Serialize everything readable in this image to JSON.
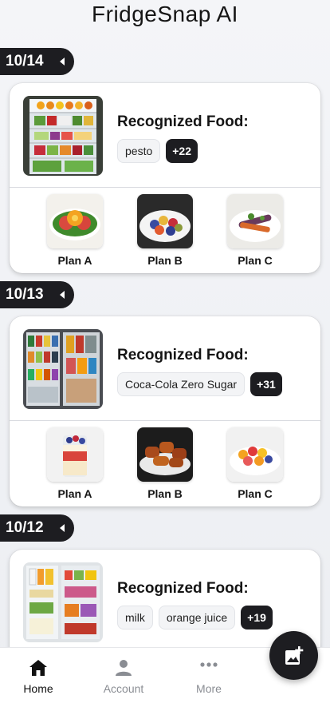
{
  "app": {
    "title": "FridgeSnap AI"
  },
  "labels": {
    "recognized": "Recognized Food:"
  },
  "entries": [
    {
      "date": "10/14",
      "foods": [
        "pesto"
      ],
      "more": "+22",
      "plans": [
        "Plan A",
        "Plan B",
        "Plan C"
      ]
    },
    {
      "date": "10/13",
      "foods": [
        "Coca-Cola Zero Sugar"
      ],
      "more": "+31",
      "plans": [
        "Plan A",
        "Plan B",
        "Plan C"
      ]
    },
    {
      "date": "10/12",
      "foods": [
        "milk",
        "orange juice"
      ],
      "more": "+19"
    }
  ],
  "tabbar": {
    "home": "Home",
    "account": "Account",
    "more": "More"
  },
  "colors": {
    "dark": "#1d1d21",
    "active_tab": "#111111",
    "inactive_tab": "#8a8d93"
  },
  "icons": {
    "date_toggle": "caret-left-icon",
    "home": "home-icon",
    "account": "person-icon",
    "more": "ellipsis-icon",
    "fab": "add-image-icon"
  }
}
